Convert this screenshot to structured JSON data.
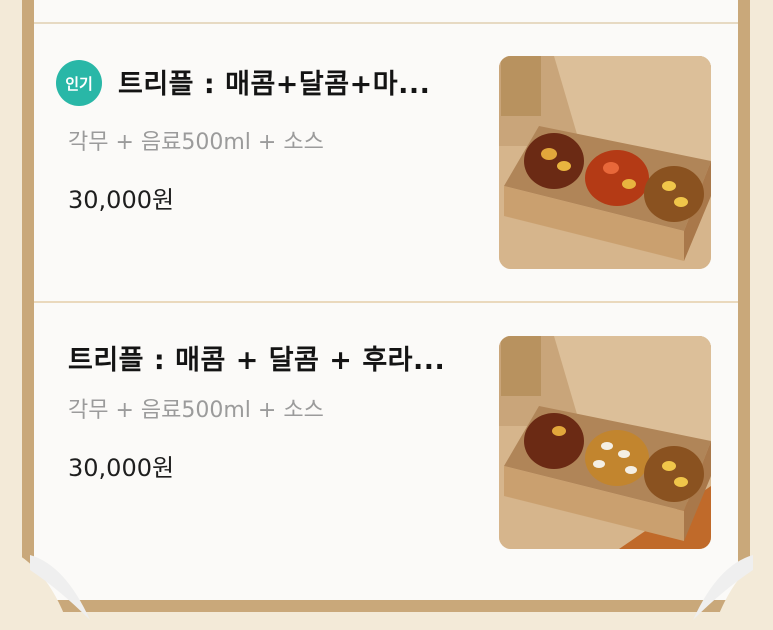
{
  "items": [
    {
      "badge": "인기",
      "title": "트리플 : 매콤+달콤+마...",
      "description": "각무 + 음료500ml + 소스",
      "price": "30,000원"
    },
    {
      "badge": "",
      "title": "트리플 : 매콤 + 달콤 + 후라...",
      "description": "각무 + 음료500ml + 소스",
      "price": "30,000원"
    }
  ],
  "colors": {
    "badge": "#29b7a7",
    "frame": "#c9a87a",
    "paper": "#fbfaf8"
  }
}
